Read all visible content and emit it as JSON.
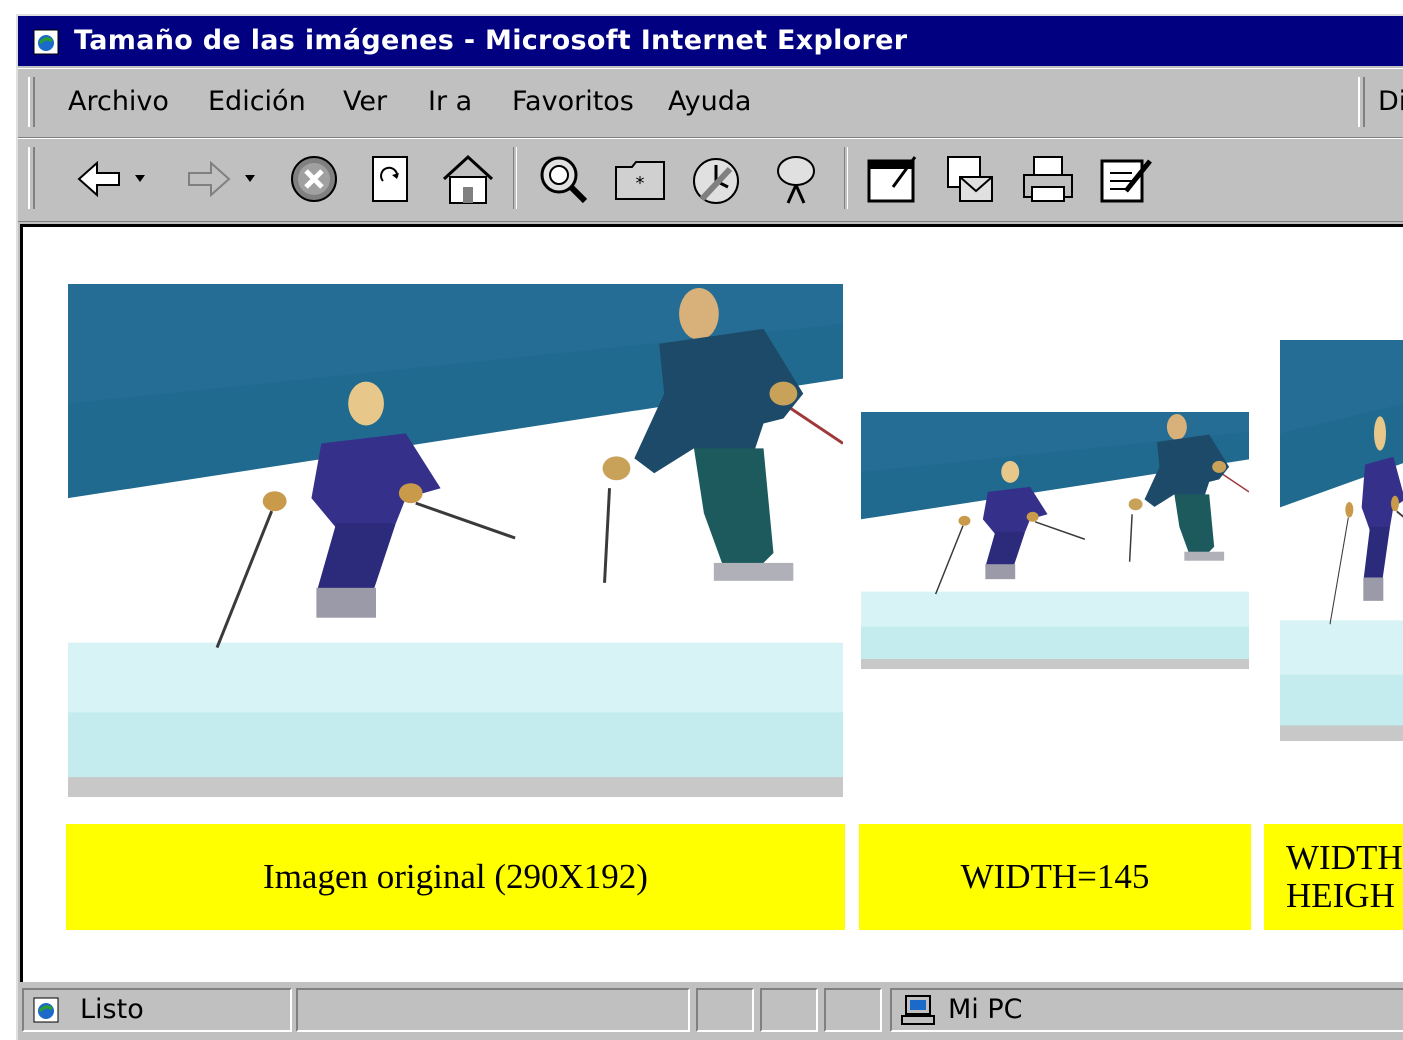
{
  "window": {
    "title": "Tamaño de las imágenes - Microsoft Internet Explorer"
  },
  "menu": {
    "items": [
      {
        "label": "Archivo"
      },
      {
        "label": "Edición"
      },
      {
        "label": "Ver"
      },
      {
        "label": "Ir a"
      },
      {
        "label": "Favoritos"
      },
      {
        "label": "Ayuda"
      }
    ],
    "links_label": "Di"
  },
  "toolbar": {
    "buttons": [
      "back-icon",
      "forward-icon",
      "stop-icon",
      "refresh-icon",
      "home-icon",
      "search-icon",
      "favorites-icon",
      "history-icon",
      "channels-icon",
      "fullscreen-icon",
      "mail-icon",
      "print-icon",
      "edit-icon"
    ]
  },
  "page": {
    "images": [
      "skiers-photo-original",
      "skiers-photo-width-145",
      "skiers-photo-width-height"
    ],
    "captions": {
      "original": "Imagen original (290X192)",
      "width": "WIDTH=145",
      "third_line1": "WIDTH",
      "third_line2": "HEIGH"
    }
  },
  "status": {
    "text": "Listo",
    "zone": "Mi PC"
  },
  "colors": {
    "titlebar": "#000080",
    "caption_bg": "#ffff00",
    "chrome": "#c0c0c0"
  }
}
